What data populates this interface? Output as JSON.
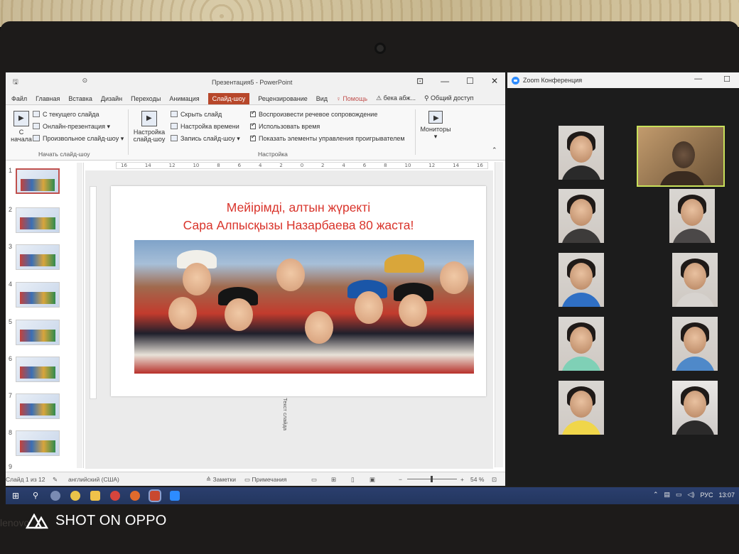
{
  "powerpoint": {
    "window_title": "Презентация5 - PowerPoint",
    "tabs": [
      "Файл",
      "Главная",
      "Вставка",
      "Дизайн",
      "Переходы",
      "Анимация",
      "Слайд-шоу",
      "Рецензирование",
      "Вид"
    ],
    "active_tab": "Слайд-шоу",
    "help_label": "Помощь",
    "user_label": "бека абж...",
    "share_label": "Общий доступ",
    "ribbon": {
      "from_start_line1": "С",
      "from_start_line2": "начала",
      "from_current": "С текущего слайда",
      "online": "Онлайн-презентация",
      "custom": "Произвольное слайд-шоу",
      "group_start": "Начать слайд-шоу",
      "setup_line1": "Настройка",
      "setup_line2": "слайд-шоу",
      "hide_slide": "Скрыть слайд",
      "rehearse": "Настройка времени",
      "record": "Запись слайд-шоу",
      "play_narrations": "Воспроизвести речевое сопровождение",
      "use_timings": "Использовать время",
      "show_controls": "Показать элементы управления проигрывателем",
      "group_setup": "Настройка",
      "monitors": "Мониторы"
    },
    "ruler_ticks": [
      "16",
      "14",
      "12",
      "10",
      "8",
      "6",
      "4",
      "2",
      "0",
      "2",
      "4",
      "6",
      "8",
      "10",
      "12",
      "14",
      "16"
    ],
    "thumbnails": [
      "1",
      "2",
      "3",
      "4",
      "5",
      "6",
      "7",
      "8",
      "9"
    ],
    "slide": {
      "title_line1": "Мейірімді, алтын жүректі",
      "title_line2": "Сара Алпысқызы Назарбаева 80 жаста!"
    },
    "notes_vertical": "Текст слайда",
    "status": {
      "slide_count": "Слайд 1 из 12",
      "language": "английский (США)",
      "notes": "Заметки",
      "comments": "Примечания",
      "zoom": "54 %"
    }
  },
  "zoom_window": {
    "title": "Zoom Конференция"
  },
  "taskbar": {
    "lang": "РУС",
    "time": "13:07"
  },
  "watermark": {
    "text": "SHOT ON OPPO"
  }
}
